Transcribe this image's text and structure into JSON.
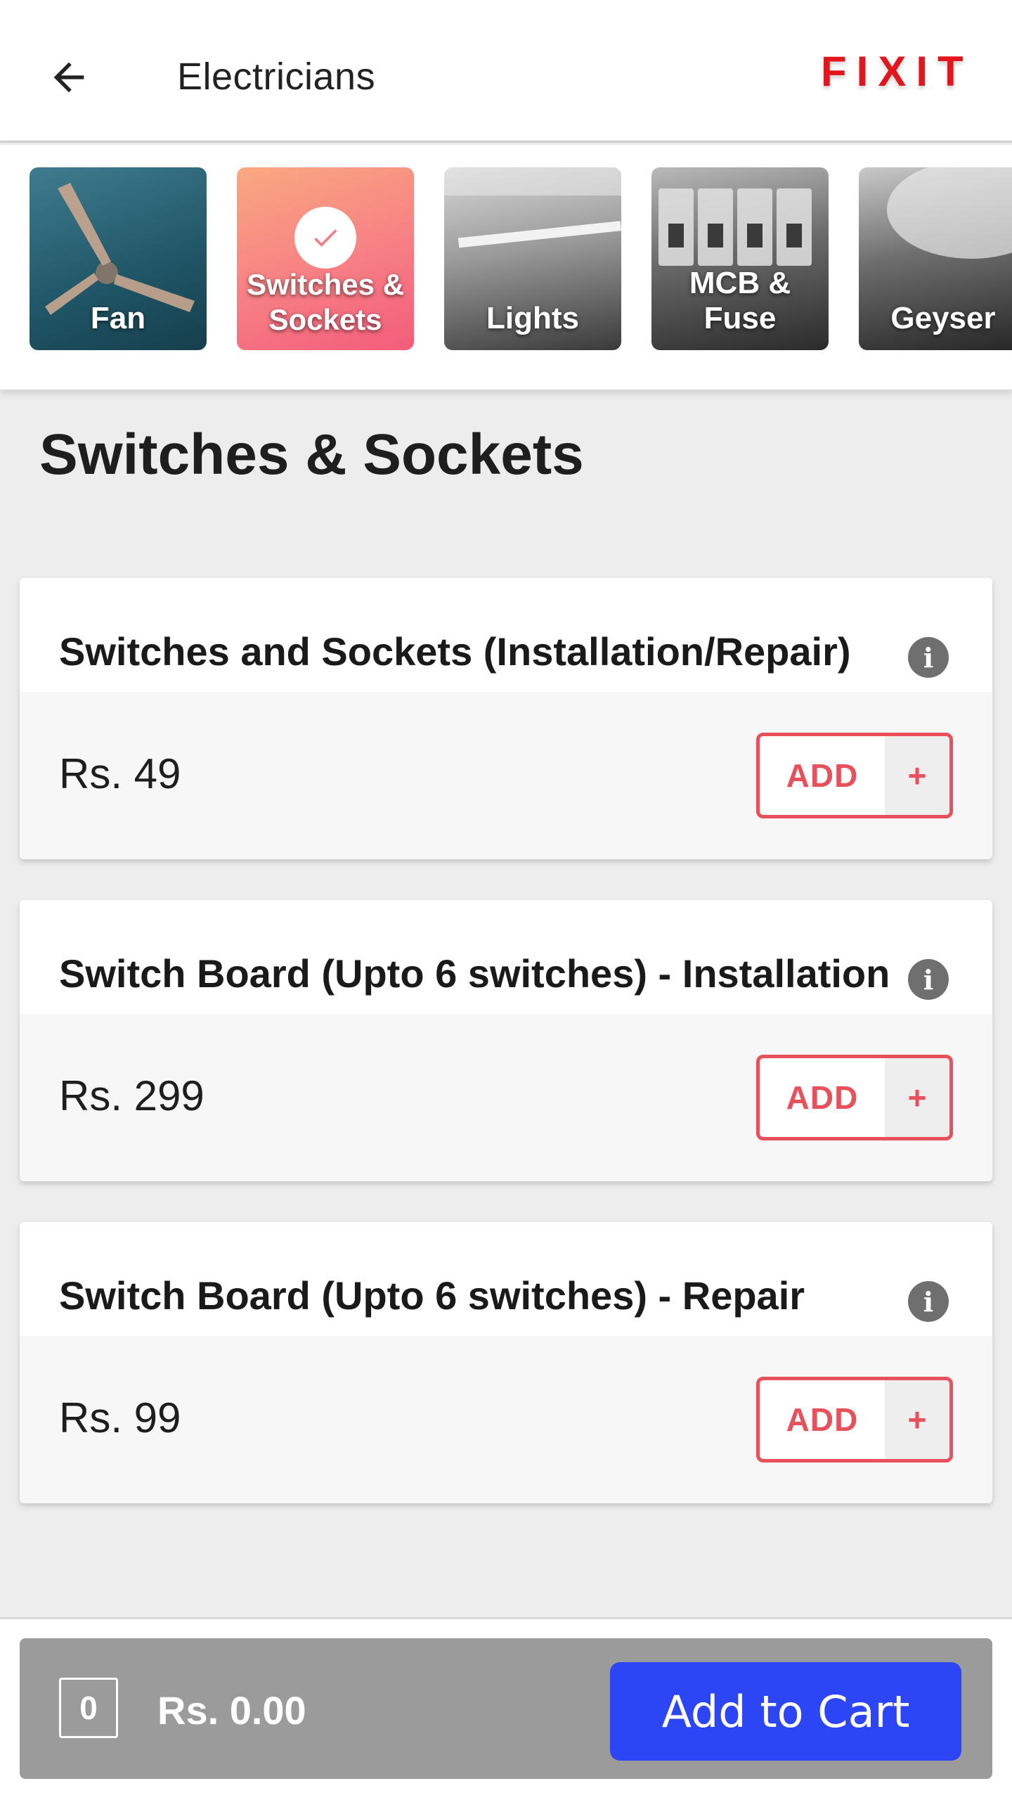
{
  "header": {
    "title": "Electricians",
    "back_icon": "arrow-left-icon",
    "logo_text": "FIXIT"
  },
  "categories": [
    {
      "label": "Fan",
      "selected": false
    },
    {
      "label": "Switches &\nSockets",
      "selected": true
    },
    {
      "label": "Lights",
      "selected": false
    },
    {
      "label": "MCB &\nFuse",
      "selected": false
    },
    {
      "label": "Geyser",
      "selected": false
    }
  ],
  "section": {
    "title": "Switches & Sockets"
  },
  "services": [
    {
      "name": "Switches and Sockets (Installation/Repair)",
      "price": "Rs. 49",
      "add_label": "ADD",
      "plus": "+"
    },
    {
      "name": "Switch Board (Upto 6 switches) - Installation",
      "price": "Rs. 299",
      "add_label": "ADD",
      "plus": "+"
    },
    {
      "name": "Switch Board (Upto 6 switches) - Repair",
      "price": "Rs. 99",
      "add_label": "ADD",
      "plus": "+"
    }
  ],
  "cart": {
    "quantity": "0",
    "total": "Rs. 0.00",
    "button_label": "Add to Cart"
  },
  "colors": {
    "accent_red": "#e8505b",
    "cart_button": "#2d46f5",
    "cart_bar": "#9b9b9b",
    "logo_red": "#e3161d"
  }
}
